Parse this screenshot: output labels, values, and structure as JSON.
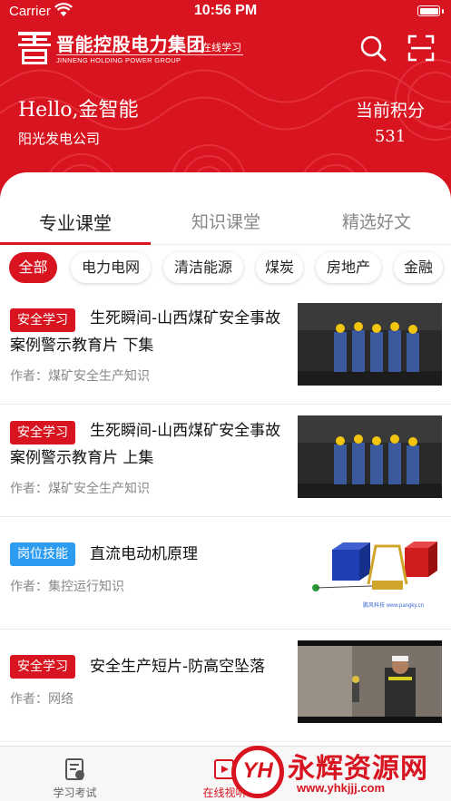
{
  "status_bar": {
    "carrier": "Carrier",
    "time": "10:56 PM"
  },
  "brand": {
    "name_cn": "晋能控股电力集团",
    "name_en": "JINNENG HOLDING POWER GROUP",
    "tag": "在线学习",
    "color": "#d7141f"
  },
  "header": {
    "search_icon": "search-icon",
    "scan_icon": "scan-icon",
    "greeting": "Hello,金智能",
    "company": "阳光发电公司",
    "points_label": "当前积分",
    "points_value": "531"
  },
  "tabs": [
    {
      "label": "专业课堂",
      "active": true
    },
    {
      "label": "知识课堂",
      "active": false
    },
    {
      "label": "精选好文",
      "active": false
    }
  ],
  "categories": [
    {
      "label": "全部",
      "active": true
    },
    {
      "label": "电力电网",
      "active": false
    },
    {
      "label": "清洁能源",
      "active": false
    },
    {
      "label": "煤炭",
      "active": false
    },
    {
      "label": "房地产",
      "active": false
    },
    {
      "label": "金融",
      "active": false
    }
  ],
  "articles": [
    {
      "badge": "安全学习",
      "badge_color": "#d7141f",
      "title": "生死瞬间-山西煤矿安全事故案例警示教育片 下集",
      "author": "作者：煤矿安全生产知识",
      "thumb": "coal-miners"
    },
    {
      "badge": "安全学习",
      "badge_color": "#d7141f",
      "title": "生死瞬间-山西煤矿安全事故案例警示教育片 上集",
      "author": "作者：煤矿安全生产知识",
      "thumb": "coal-miners"
    },
    {
      "badge": "岗位技能",
      "badge_color": "#2d9cf0",
      "title": "直流电动机原理",
      "author": "作者：集控运行知识",
      "thumb": "dc-motor-diagram",
      "thumb_caption": "鹏风科技 www.pangky.cn"
    },
    {
      "badge": "安全学习",
      "badge_color": "#d7141f",
      "title": "安全生产短片-防高空坠落",
      "author": "作者：网络",
      "thumb": "safety-worker"
    }
  ],
  "tabbar": [
    {
      "label": "学习考试",
      "icon": "exam-icon",
      "active": false
    },
    {
      "label": "在线视听",
      "icon": "video-icon",
      "active": true
    }
  ],
  "watermark": {
    "logo": "YH",
    "name": "永辉资源网",
    "url": "www.yhkjjj.com"
  }
}
